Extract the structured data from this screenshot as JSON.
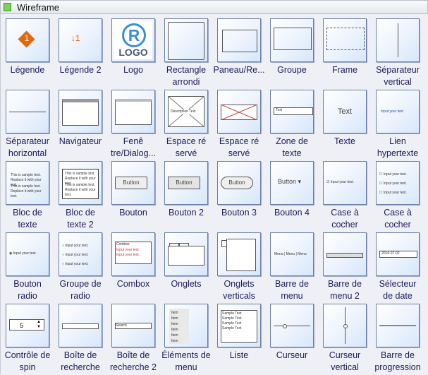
{
  "header": {
    "title": "Wireframe"
  },
  "items": [
    {
      "id": "legende",
      "label": "Légende"
    },
    {
      "id": "legende-2",
      "label": "Légende 2"
    },
    {
      "id": "logo",
      "label": "Logo",
      "logo_text": "LOGO",
      "logo_letter": "R"
    },
    {
      "id": "rectangle-arrondi",
      "label": "Rectangle\narrondi"
    },
    {
      "id": "panneau",
      "label": "Paneau/Re..."
    },
    {
      "id": "groupe",
      "label": "Groupe"
    },
    {
      "id": "frame",
      "label": "Frame"
    },
    {
      "id": "separateur-vertical",
      "label": "Séparateur\nvertical"
    },
    {
      "id": "separateur-horizontal",
      "label": "Séparateur\nhorizontal"
    },
    {
      "id": "navigateur",
      "label": "Navigateur"
    },
    {
      "id": "fenetre",
      "label": "Fenê\ntre/Dialog..."
    },
    {
      "id": "espace-reserve",
      "label": "Espace ré\nservé",
      "inner": "Description Text"
    },
    {
      "id": "espace-reserve-2",
      "label": "Espace ré\nservé"
    },
    {
      "id": "zone-de-texte",
      "label": "Zone de\ntexte",
      "inner": "Text"
    },
    {
      "id": "texte",
      "label": "Texte",
      "inner": "Text"
    },
    {
      "id": "lien-hypertexte",
      "label": "Lien\nhypertexte",
      "inner": "Input your text."
    },
    {
      "id": "bloc-de-texte",
      "label": "Bloc de\ntexte",
      "inner": "This is sample text. Replace it with your text."
    },
    {
      "id": "bloc-de-texte-2",
      "label": "Bloc de\ntexte 2",
      "inner": "This is sample text. Replace it with your text."
    },
    {
      "id": "bouton",
      "label": "Bouton",
      "inner": "Button"
    },
    {
      "id": "bouton-2",
      "label": "Bouton 2",
      "inner": "Button"
    },
    {
      "id": "bouton-3",
      "label": "Bouton 3",
      "inner": "Button"
    },
    {
      "id": "bouton-4",
      "label": "Bouton 4",
      "inner": "Button"
    },
    {
      "id": "case-a-cocher",
      "label": "Case à\ncocher",
      "inner": "Input your text."
    },
    {
      "id": "case-a-cocher-2",
      "label": "Case à\ncocher",
      "inner": "Input your text."
    },
    {
      "id": "bouton-radio",
      "label": "Bouton\nradio",
      "inner": "Input your text."
    },
    {
      "id": "groupe-de-radio",
      "label": "Groupe de\nradio",
      "inner": "Input your text."
    },
    {
      "id": "combox",
      "label": "Combox",
      "inner": "Combox",
      "sub": "Input your text."
    },
    {
      "id": "onglets",
      "label": "Onglets"
    },
    {
      "id": "onglets-verticals",
      "label": "Onglets\nverticals"
    },
    {
      "id": "barre-de-menu",
      "label": "Barre de\nmenu",
      "inner": "Menu"
    },
    {
      "id": "barre-de-menu-2",
      "label": "Barre de\nmenu 2"
    },
    {
      "id": "selecteur-de-date",
      "label": "Sélecteur\nde date",
      "inner": "2016-07-02"
    },
    {
      "id": "controle-de-spin",
      "label": "Contrôle de\nspin",
      "inner": "5"
    },
    {
      "id": "boite-de-recherche",
      "label": "Boîte de\nrecherche"
    },
    {
      "id": "boite-de-recherche-2",
      "label": "Boîte de\nrecherche 2",
      "inner": "Search"
    },
    {
      "id": "elements-de-menu",
      "label": "Éléments de\nmenu",
      "inner": "Item"
    },
    {
      "id": "liste",
      "label": "Liste",
      "inner": "Sample Text"
    },
    {
      "id": "curseur",
      "label": "Curseur"
    },
    {
      "id": "curseur-vertical",
      "label": "Curseur\nvertical"
    },
    {
      "id": "barre-de-progression",
      "label": "Barre de\nprogression"
    }
  ],
  "colors": {
    "accent": "#e8650a",
    "logo": "#3b8fd6",
    "label": "#1d1d5c"
  }
}
